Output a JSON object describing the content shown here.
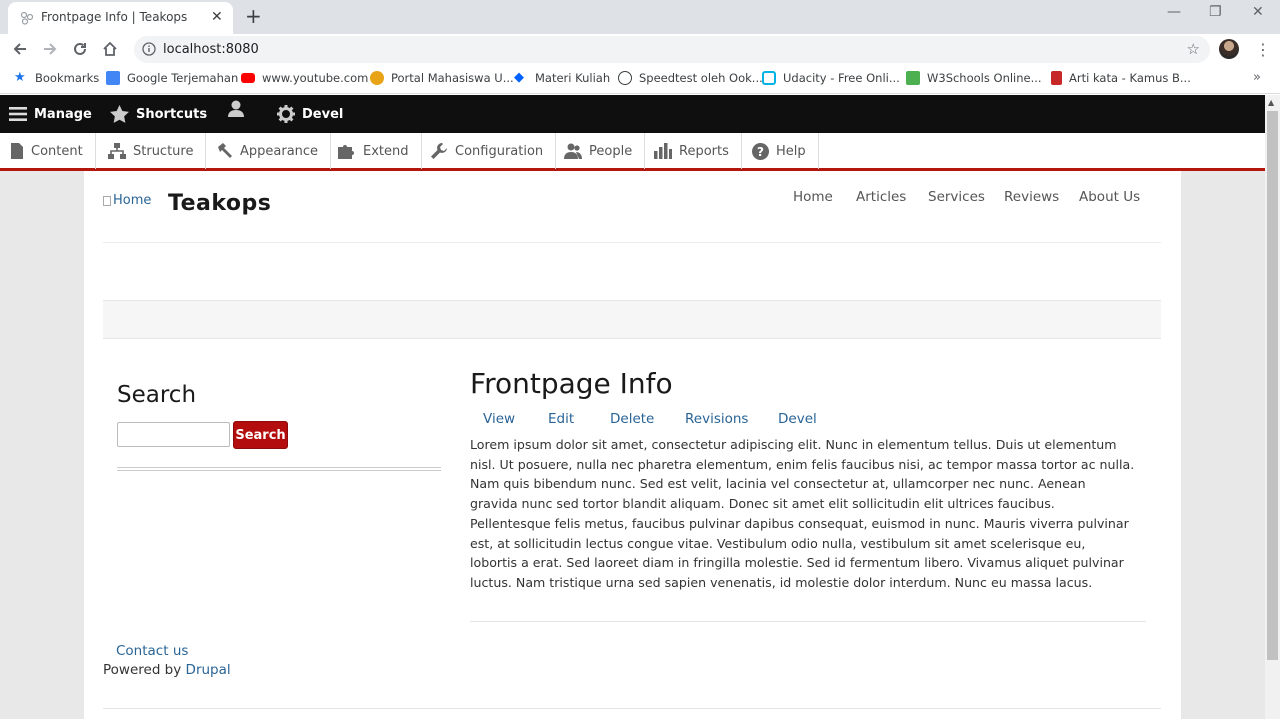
{
  "browser": {
    "tab_title": "Frontpage Info | Teakops",
    "new_tab": "+",
    "url": "localhost:8080",
    "bookmarks": [
      {
        "label": "Bookmarks",
        "icon": "star-icon",
        "color": "#1a73e8"
      },
      {
        "label": "Google Terjemahan",
        "icon": "google-translate-icon",
        "color": "#4285f4"
      },
      {
        "label": "www.youtube.com",
        "icon": "youtube-icon",
        "color": "#ff0000"
      },
      {
        "label": "Portal Mahasiswa U...",
        "icon": "portal-icon",
        "color": "#e8a317"
      },
      {
        "label": "Materi Kuliah",
        "icon": "dropbox-icon",
        "color": "#0061fe"
      },
      {
        "label": "Speedtest oleh Ook...",
        "icon": "speedtest-icon",
        "color": "#3c4043"
      },
      {
        "label": "Udacity - Free Onli...",
        "icon": "udacity-icon",
        "color": "#02b3e4"
      },
      {
        "label": "W3Schools Online...",
        "icon": "w3schools-icon",
        "color": "#4caf50"
      },
      {
        "label": "Arti kata - Kamus B...",
        "icon": "kamus-icon",
        "color": "#c62828"
      }
    ]
  },
  "admin_toolbar": {
    "manage": "Manage",
    "shortcuts": "Shortcuts",
    "devel": "Devel",
    "tray": [
      {
        "label": "Content",
        "icon": "content-icon"
      },
      {
        "label": "Structure",
        "icon": "structure-icon"
      },
      {
        "label": "Appearance",
        "icon": "appearance-icon"
      },
      {
        "label": "Extend",
        "icon": "extend-icon"
      },
      {
        "label": "Configuration",
        "icon": "configuration-icon"
      },
      {
        "label": "People",
        "icon": "people-icon"
      },
      {
        "label": "Reports",
        "icon": "reports-icon"
      },
      {
        "label": "Help",
        "icon": "help-icon"
      }
    ],
    "accent_color": "#b3160d"
  },
  "site": {
    "logo_alt": "Home",
    "name": "Teakops",
    "main_menu": [
      "Home",
      "Articles",
      "Services",
      "Reviews",
      "About Us"
    ]
  },
  "sidebar": {
    "search_title": "Search",
    "search_button": "Search",
    "search_value": ""
  },
  "node": {
    "title": "Frontpage Info",
    "tabs": [
      "View",
      "Edit",
      "Delete",
      "Revisions",
      "Devel"
    ],
    "body": "Lorem ipsum dolor sit amet, consectetur adipiscing elit. Nunc in elementum tellus. Duis ut elementum nisl. Ut posuere, nulla nec pharetra elementum, enim felis faucibus nisi, ac tempor massa tortor ac nulla. Nam quis bibendum nunc. Sed est velit, lacinia vel consectetur at, ullamcorper nec nunc. Aenean gravida nunc sed tortor blandit aliquam. Donec sit amet elit sollicitudin elit ultrices faucibus. Pellentesque felis metus, faucibus pulvinar dapibus consequat, euismod in nunc. Mauris viverra pulvinar est, at sollicitudin lectus congue vitae. Vestibulum odio nulla, vestibulum sit amet scelerisque eu, lobortis a erat. Sed laoreet diam in fringilla molestie. Sed id fermentum libero. Vivamus aliquet pulvinar luctus. Nam tristique urna sed sapien venenatis, id molestie dolor interdum. Nunc eu massa lacus."
  },
  "footer": {
    "contact": "Contact us",
    "powered_prefix": "Powered by ",
    "powered_link": "Drupal"
  }
}
